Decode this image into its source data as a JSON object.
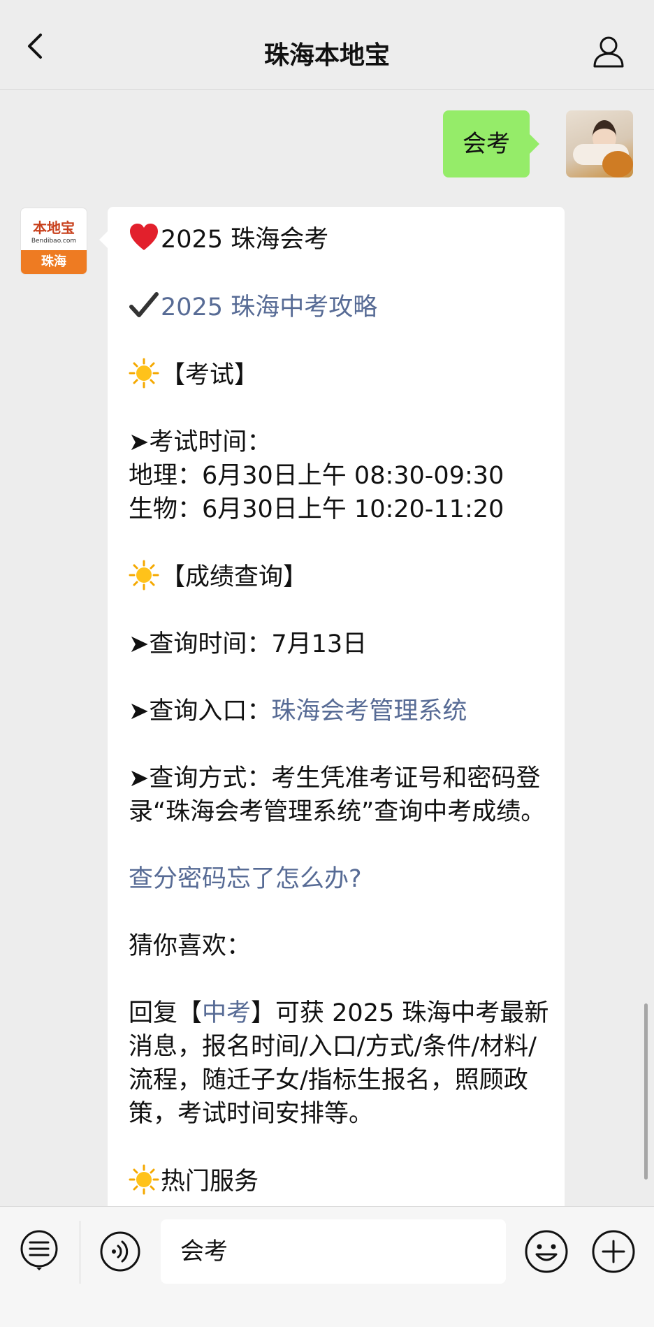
{
  "header": {
    "title": "珠海本地宝"
  },
  "sent_message": {
    "text": "会考"
  },
  "account_avatar": {
    "brand": "本地宝",
    "site": "Bendibao.com",
    "city": "珠海"
  },
  "reply": {
    "title": "2025 珠海会考",
    "guide_link": "2025 珠海中考攻略",
    "section_exam": "【考试】",
    "exam_time_label": "➤考试时间：",
    "geography": "地理：6月30日上午 08:30-09:30",
    "biology": "生物：6月30日上午 10:20-11:20",
    "section_score": "【成绩查询】",
    "query_time": "➤查询时间：7月13日",
    "query_entry_label": "➤查询入口：",
    "query_entry_link": "珠海会考管理系统",
    "query_method": "➤查询方式：考生凭准考证号和密码登录“珠海会考管理系统”查询中考成绩。",
    "forgot_link": "查分密码忘了怎么办?",
    "guess_like": "猜你喜欢：",
    "reply_prefix": "回复【",
    "reply_keyword": "中考",
    "reply_suffix": "】可获 2025 珠海中考最新消息，报名时间/入口/方式/条件/材料/流程，随迁子女/指标生报名，照顾政策，考试时间安排等。",
    "section_hot": "热门服务"
  },
  "input": {
    "value": "会考"
  },
  "icons": [
    "back-icon",
    "user-icon",
    "heart-icon",
    "check-icon",
    "sun-icon",
    "menu-list-icon",
    "voice-icon",
    "emoji-icon",
    "plus-icon"
  ],
  "colors": {
    "background": "#ededed",
    "sent_bubble": "#95ec69",
    "link": "#576b95",
    "brand_orange": "#ee7b22"
  }
}
